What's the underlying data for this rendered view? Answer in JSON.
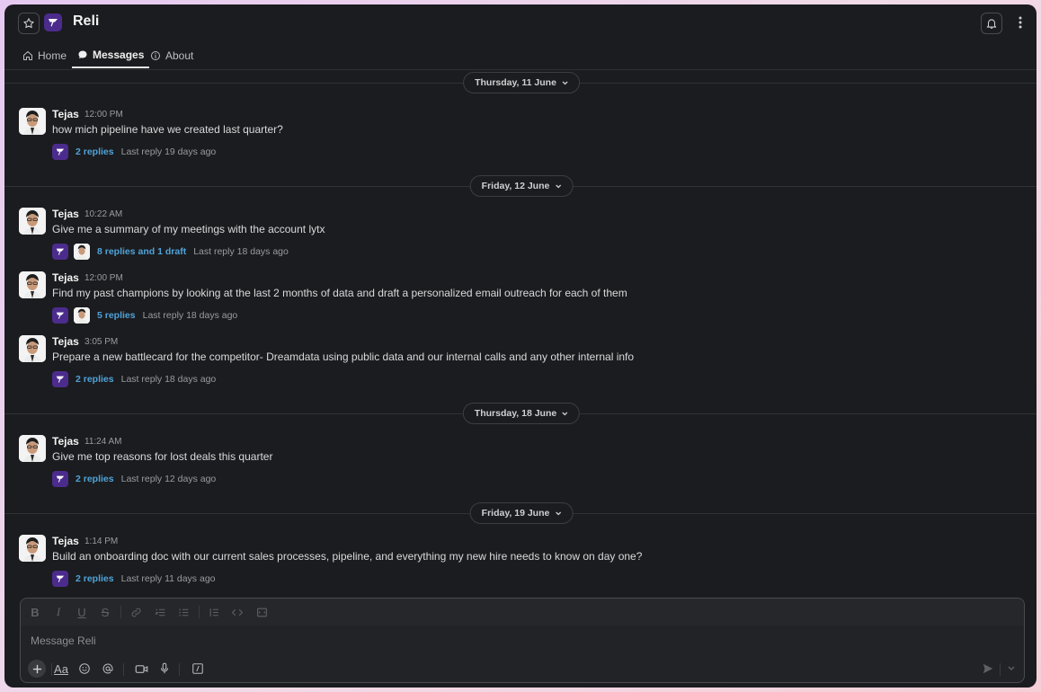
{
  "app": {
    "title": "Reli"
  },
  "tabs": [
    {
      "label": "Home",
      "icon": "home-icon",
      "active": false
    },
    {
      "label": "Messages",
      "icon": "message-icon",
      "active": true
    },
    {
      "label": "About",
      "icon": "info-icon",
      "active": false
    }
  ],
  "dividers": [
    {
      "label": "Thursday, 11 June"
    },
    {
      "label": "Friday, 12 June"
    },
    {
      "label": "Thursday, 18 June"
    },
    {
      "label": "Friday, 19 June"
    }
  ],
  "messages": [
    {
      "author": "Tejas",
      "time": "12:00 PM",
      "text": "how mich pipeline have we created last quarter?",
      "replies": "2 replies",
      "last_reply": "Last reply 19 days ago",
      "participant_avatar": false
    },
    {
      "author": "Tejas",
      "time": "10:22 AM",
      "text": "Give me a summary of my meetings with the account lytx",
      "replies": "8 replies and 1 draft",
      "last_reply": "Last reply 18 days ago",
      "participant_avatar": true
    },
    {
      "author": "Tejas",
      "time": "12:00 PM",
      "text": "Find my past champions by looking at the last 2 months of data and draft a personalized email outreach for each of them",
      "replies": "5 replies",
      "last_reply": "Last reply 18 days ago",
      "participant_avatar": true
    },
    {
      "author": "Tejas",
      "time": "3:05 PM",
      "text": "Prepare a new battlecard for the competitor-  Dreamdata  using public data and our internal calls and any other internal info",
      "replies": "2 replies",
      "last_reply": "Last reply 18 days ago",
      "participant_avatar": false
    },
    {
      "author": "Tejas",
      "time": "11:24 AM",
      "text": "Give me top reasons for lost deals this quarter",
      "replies": "2 replies",
      "last_reply": "Last reply 12 days ago",
      "participant_avatar": false
    },
    {
      "author": "Tejas",
      "time": "1:14 PM",
      "text": "Build an onboarding doc with our current sales processes, pipeline, and everything my new hire needs to know on day one?",
      "replies": "2 replies",
      "last_reply": "Last reply 11 days ago",
      "participant_avatar": false
    }
  ],
  "composer": {
    "placeholder": "Message Reli",
    "format_tools": [
      "bold-icon",
      "italic-icon",
      "underline-icon",
      "strikethrough-icon",
      "link-icon",
      "ordered-list-icon",
      "bulleted-list-icon",
      "blockquote-icon",
      "code-icon",
      "code-block-icon"
    ],
    "tools": [
      "plus-icon",
      "text-format-icon",
      "emoji-icon",
      "mention-icon",
      "video-icon",
      "microphone-icon",
      "slash-command-icon"
    ],
    "text_format_label": "Aa"
  },
  "colors": {
    "background": "#1b1c1f",
    "accent": "#4b2c8c",
    "link": "#4fa3d9"
  }
}
